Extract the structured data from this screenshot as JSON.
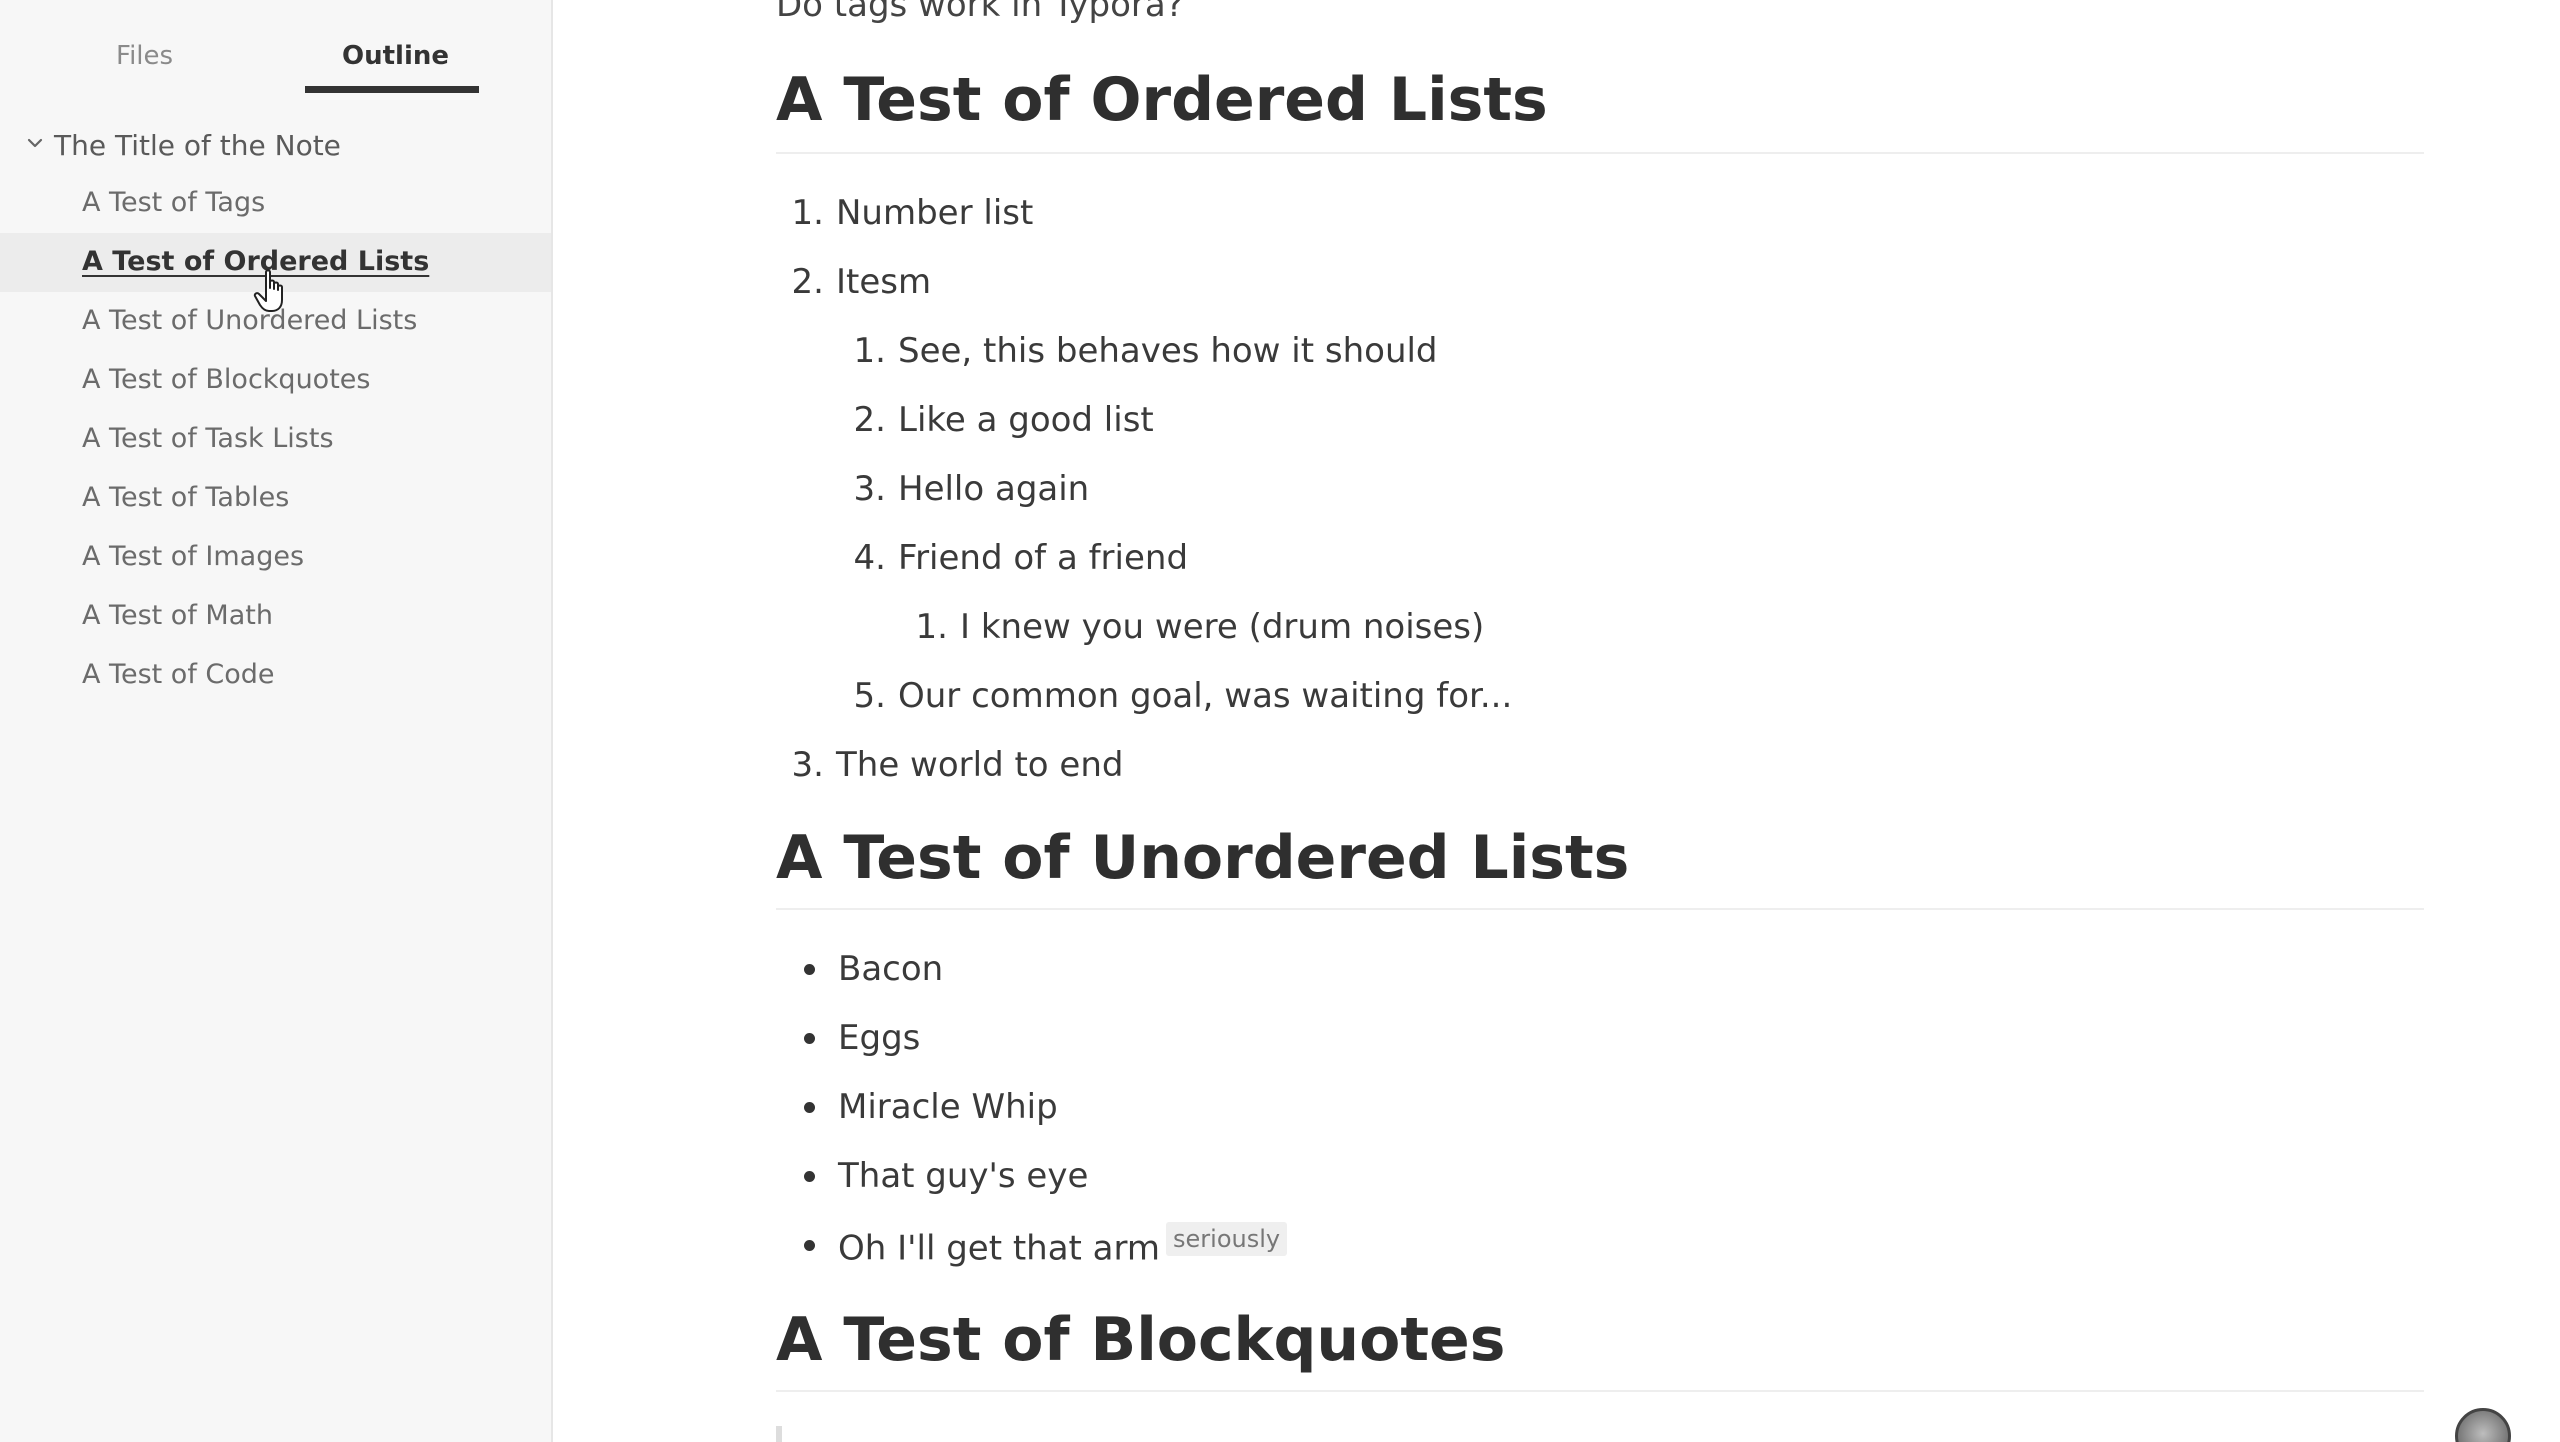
{
  "sidebar": {
    "tabs": {
      "files": "Files",
      "outline": "Outline"
    },
    "outline": {
      "root": "The Title of the Note",
      "items": [
        {
          "label": "A Test of Tags"
        },
        {
          "label": "A Test of Ordered Lists",
          "active": true
        },
        {
          "label": "A Test of Unordered Lists"
        },
        {
          "label": "A Test of Blockquotes"
        },
        {
          "label": "A Test of Task Lists"
        },
        {
          "label": "A Test of Tables"
        },
        {
          "label": "A Test of Images"
        },
        {
          "label": "A Test of Math"
        },
        {
          "label": "A Test of Code"
        }
      ]
    }
  },
  "document": {
    "top_cut_text": "Do tags work in Typora?",
    "sections": {
      "ordered": {
        "heading": "A Test of Ordered Lists",
        "items": [
          {
            "num": "1.",
            "text": "Number list"
          },
          {
            "num": "2.",
            "text": "Itesm"
          },
          {
            "num": "1.",
            "text": "See, this behaves how it should"
          },
          {
            "num": "2.",
            "text": "Like a good list"
          },
          {
            "num": "3.",
            "text": "Hello again"
          },
          {
            "num": "4.",
            "text": "Friend of a friend"
          },
          {
            "num": "1.",
            "text": "I knew you were (drum noises)"
          },
          {
            "num": "5.",
            "text": "Our common goal, was waiting for..."
          },
          {
            "num": "3.",
            "text": "The world to end"
          }
        ]
      },
      "unordered": {
        "heading": "A Test of Unordered Lists",
        "items": [
          {
            "text": "Bacon"
          },
          {
            "text": "Eggs"
          },
          {
            "text": "Miracle Whip"
          },
          {
            "text": "That guy's eye"
          },
          {
            "text": "Oh I'll get that arm",
            "tag": "seriously"
          }
        ]
      },
      "blockquotes": {
        "heading": "A Test of Blockquotes"
      }
    }
  },
  "icons": {
    "chevron": "chevron-down-icon",
    "cursor": "hand-pointer-icon",
    "avatar": "user-avatar"
  }
}
